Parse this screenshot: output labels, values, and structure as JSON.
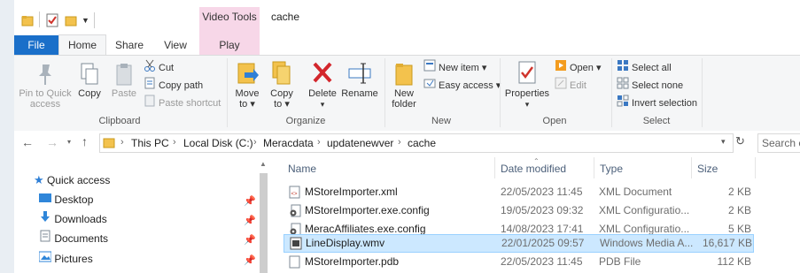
{
  "window": {
    "title": "cache",
    "context_tab": "Video Tools"
  },
  "tabs": [
    {
      "label": "File"
    },
    {
      "label": "Home"
    },
    {
      "label": "Share"
    },
    {
      "label": "View"
    },
    {
      "label": "Play"
    }
  ],
  "ribbon": {
    "clipboard": {
      "group": "Clipboard",
      "pin_line1": "Pin to Quick",
      "pin_line2": "access",
      "copy": "Copy",
      "paste": "Paste",
      "cut": "Cut",
      "copy_path": "Copy path",
      "paste_shortcut": "Paste shortcut"
    },
    "organize": {
      "group": "Organize",
      "move_line1": "Move",
      "move_line2": "to",
      "copy_line1": "Copy",
      "copy_line2": "to",
      "delete": "Delete",
      "rename": "Rename"
    },
    "new": {
      "group": "New",
      "folder_line1": "New",
      "folder_line2": "folder",
      "new_item": "New item",
      "easy_access": "Easy access"
    },
    "open": {
      "group": "Open",
      "properties": "Properties",
      "open": "Open",
      "edit": "Edit"
    },
    "select": {
      "group": "Select",
      "select_all": "Select all",
      "select_none": "Select none",
      "invert": "Invert selection"
    }
  },
  "address": {
    "crumbs": [
      "This PC",
      "Local Disk (C:)",
      "Meracdata",
      "updatenewver",
      "cache"
    ],
    "search_placeholder": "Search c"
  },
  "nav_pane": {
    "items": [
      {
        "label": "Quick access",
        "icon": "star-icon",
        "pinned": false
      },
      {
        "label": "Desktop",
        "icon": "desktop-icon",
        "pinned": true
      },
      {
        "label": "Downloads",
        "icon": "downloads-icon",
        "pinned": true
      },
      {
        "label": "Documents",
        "icon": "documents-icon",
        "pinned": true
      },
      {
        "label": "Pictures",
        "icon": "pictures-icon",
        "pinned": true
      }
    ]
  },
  "file_list": {
    "columns": {
      "name": "Name",
      "date": "Date modified",
      "type": "Type",
      "size": "Size"
    },
    "rows": [
      {
        "name": "MStoreImporter.xml",
        "date": "22/05/2023 11:45",
        "type": "XML Document",
        "size": "2 KB",
        "icon": "xml-file-icon",
        "selected": false
      },
      {
        "name": "MStoreImporter.exe.config",
        "date": "19/05/2023 09:32",
        "type": "XML Configuratio...",
        "size": "2 KB",
        "icon": "config-file-icon",
        "selected": false
      },
      {
        "name": "MeracAffiliates.exe.config",
        "date": "14/08/2023 17:41",
        "type": "XML Configuratio...",
        "size": "5 KB",
        "icon": "config-file-icon",
        "selected": false
      },
      {
        "name": "LineDisplay.wmv",
        "date": "22/01/2025 09:57",
        "type": "Windows Media A...",
        "size": "16,617 KB",
        "icon": "video-file-icon",
        "selected": true
      },
      {
        "name": "MStoreImporter.pdb",
        "date": "22/05/2023 11:45",
        "type": "PDB File",
        "size": "112 KB",
        "icon": "pdb-file-icon",
        "selected": false
      }
    ]
  },
  "colors": {
    "accent": "#1a6fc9",
    "context_tab": "#f7d7e8",
    "selection": "#cce8ff",
    "selection_border": "#99d1ff"
  }
}
